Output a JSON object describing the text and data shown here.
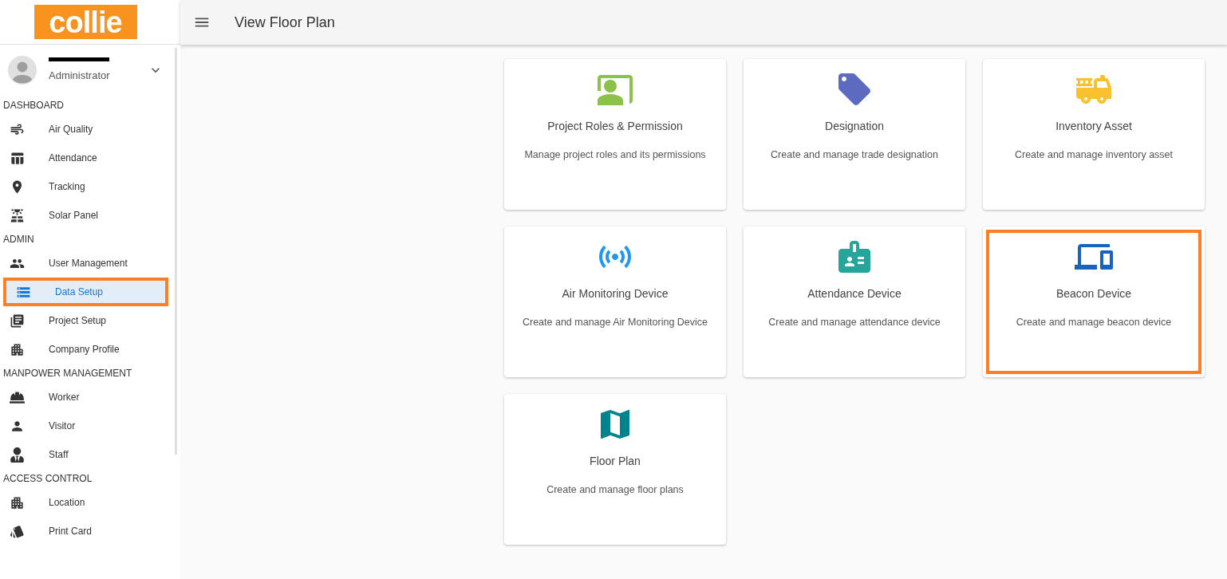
{
  "logo": {
    "text": "collie"
  },
  "user": {
    "role": "Administrator"
  },
  "header": {
    "title": "View Floor Plan"
  },
  "sidebar": {
    "sections": [
      {
        "title": "DASHBOARD",
        "items": [
          {
            "label": "Air Quality",
            "selected": false,
            "highlighted": false
          },
          {
            "label": "Attendance",
            "selected": false,
            "highlighted": false
          },
          {
            "label": "Tracking",
            "selected": false,
            "highlighted": false
          },
          {
            "label": "Solar Panel",
            "selected": false,
            "highlighted": false
          }
        ]
      },
      {
        "title": "ADMIN",
        "items": [
          {
            "label": "User Management",
            "selected": false,
            "highlighted": false
          },
          {
            "label": "Data Setup",
            "selected": true,
            "highlighted": true
          },
          {
            "label": "Project Setup",
            "selected": false,
            "highlighted": false
          },
          {
            "label": "Company Profile",
            "selected": false,
            "highlighted": false
          }
        ]
      },
      {
        "title": "MANPOWER MANAGEMENT",
        "items": [
          {
            "label": "Worker",
            "selected": false,
            "highlighted": false
          },
          {
            "label": "Visitor",
            "selected": false,
            "highlighted": false
          },
          {
            "label": "Staff",
            "selected": false,
            "highlighted": false
          }
        ]
      },
      {
        "title": "ACCESS CONTROL",
        "items": [
          {
            "label": "Location",
            "selected": false,
            "highlighted": false
          },
          {
            "label": "Print Card",
            "selected": false,
            "highlighted": false
          }
        ]
      }
    ]
  },
  "cards": [
    {
      "title": "Project Roles & Permission",
      "description": "Manage project roles and its permissions",
      "color": "#8bc34a",
      "highlighted": false
    },
    {
      "title": "Designation",
      "description": "Create and manage trade designation",
      "color": "#5c6bc0",
      "highlighted": false
    },
    {
      "title": "Inventory Asset",
      "description": "Create and manage inventory asset",
      "color": "#fbc02d",
      "highlighted": false
    },
    {
      "title": "Air Monitoring Device",
      "description": "Create and manage Air Monitoring Device",
      "color": "#2196f3",
      "highlighted": false
    },
    {
      "title": "Attendance Device",
      "description": "Create and manage attendance device",
      "color": "#26a69a",
      "highlighted": false
    },
    {
      "title": "Beacon Device",
      "description": "Create and manage beacon device",
      "color": "#1565c0",
      "highlighted": true
    },
    {
      "title": "Floor Plan",
      "description": "Create and manage floor plans",
      "color": "#00838f",
      "highlighted": false
    }
  ]
}
